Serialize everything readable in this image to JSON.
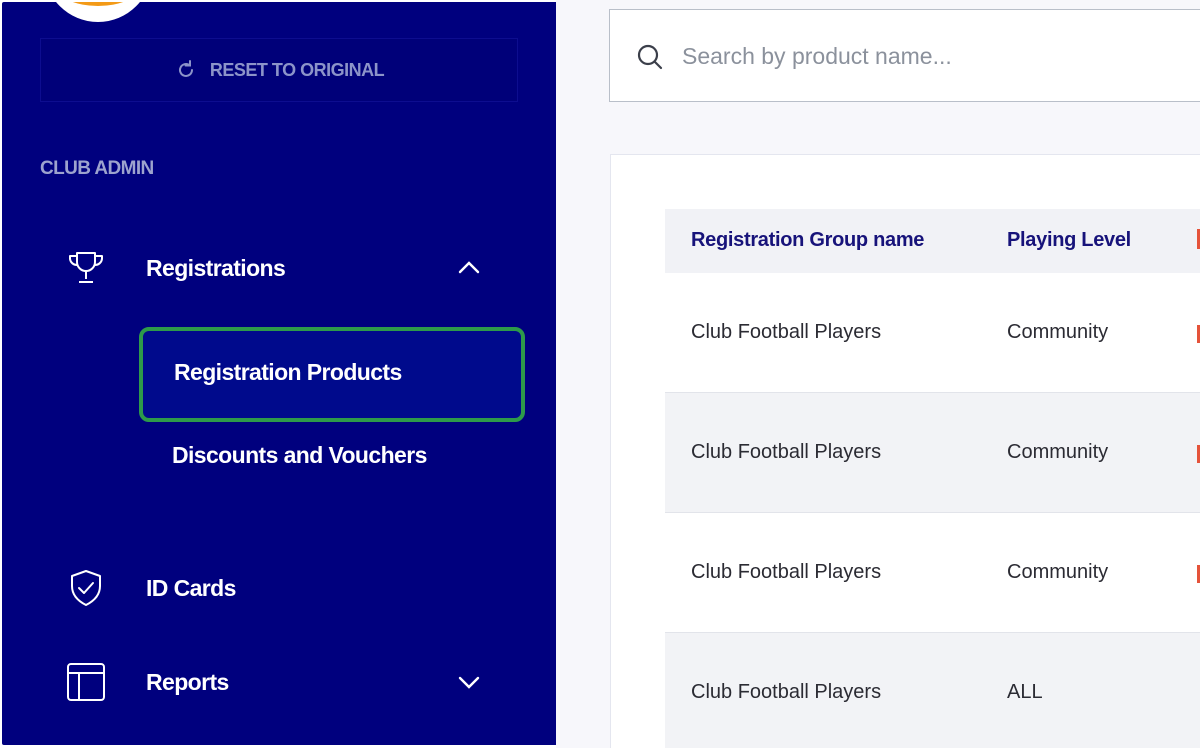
{
  "sidebar": {
    "reset_label": "RESET TO ORIGINAL",
    "reset_icon": "refresh-icon",
    "section_label": "CLUB ADMIN",
    "items": [
      {
        "label": "Registrations",
        "icon": "trophy-icon",
        "chevron": "chevron-up-icon",
        "expanded": true
      },
      {
        "label": "ID Cards",
        "icon": "shield-check-icon"
      },
      {
        "label": "Reports",
        "icon": "layout-icon",
        "chevron": "chevron-down-icon",
        "expanded": false
      }
    ],
    "subitems": [
      {
        "label": "Registration Products",
        "active": true
      },
      {
        "label": "Discounts and Vouchers",
        "active": false
      }
    ]
  },
  "search": {
    "placeholder": "Search by product name...",
    "icon": "search-icon"
  },
  "table": {
    "columns": [
      "Registration Group name",
      "Playing Level"
    ],
    "rows": [
      [
        "Club Football Players",
        "Community"
      ],
      [
        "Club Football Players",
        "Community"
      ],
      [
        "Club Football Players",
        "Community"
      ],
      [
        "Club Football Players",
        "ALL"
      ]
    ]
  },
  "colors": {
    "sidebar_bg": "#00007e",
    "active_border": "#2d9a4a",
    "header_text": "#17137a",
    "accent_orange": "#f39a17"
  }
}
